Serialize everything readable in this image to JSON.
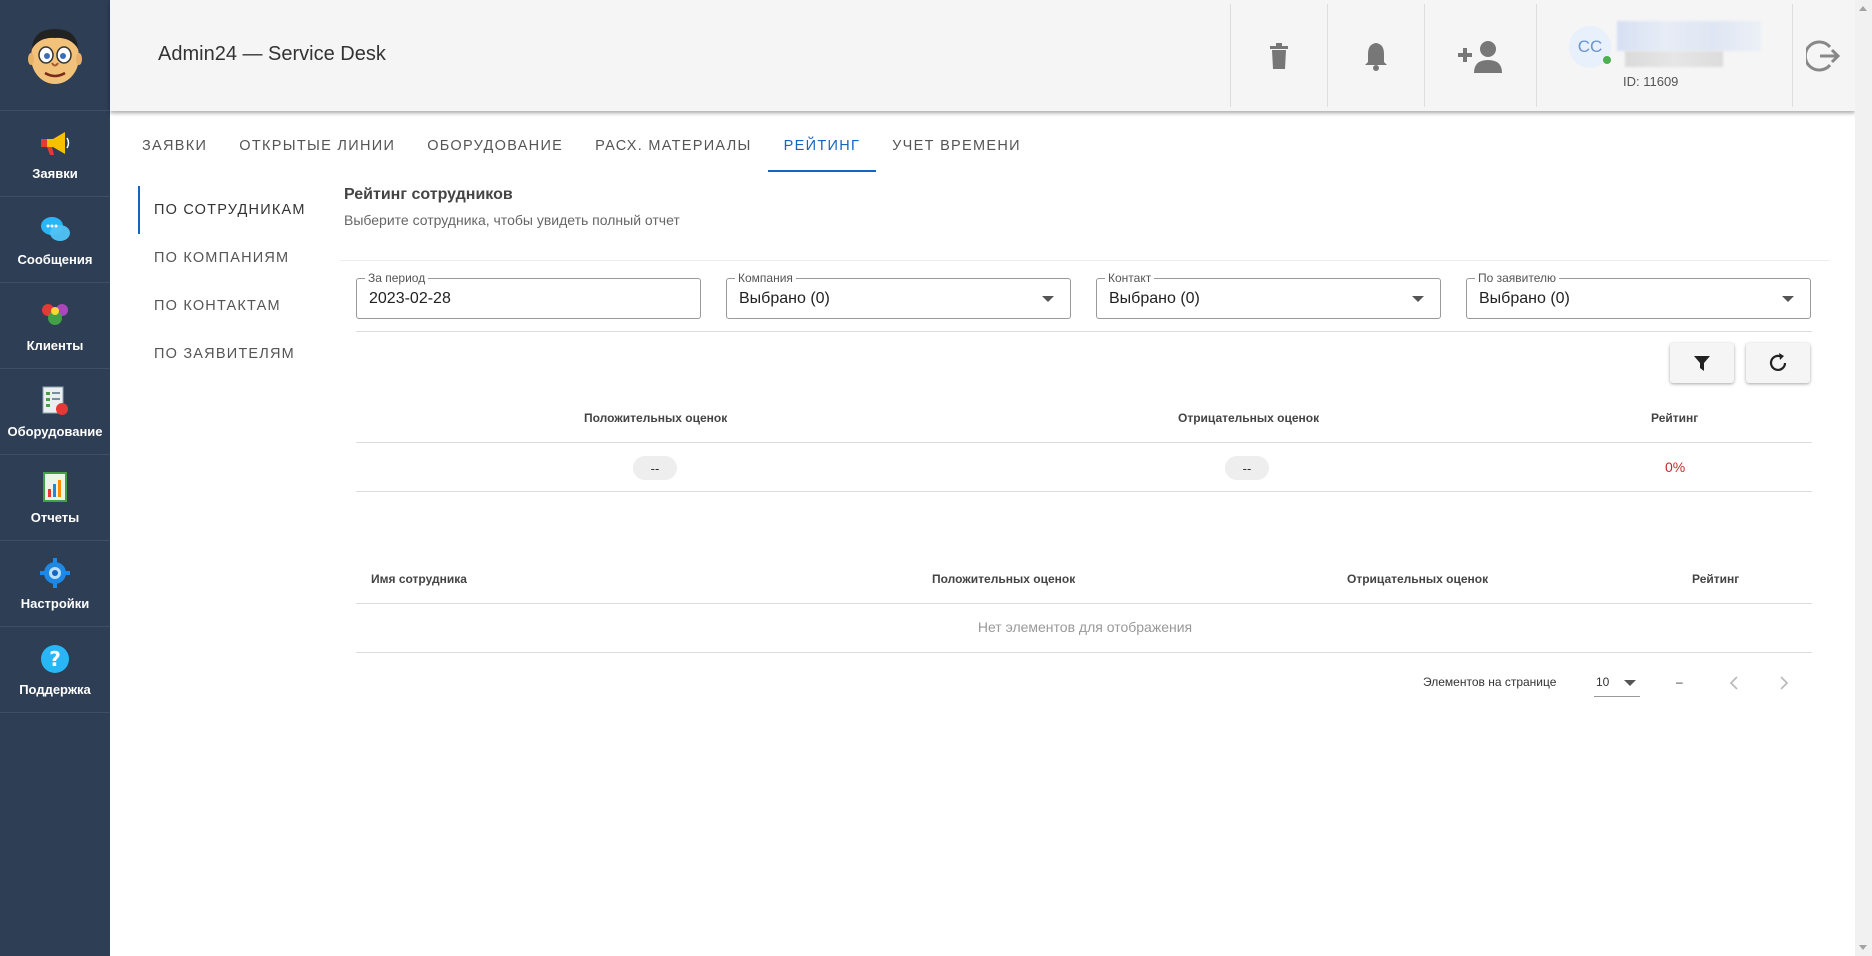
{
  "app": {
    "title": "Admin24 — Service Desk"
  },
  "sidebar": {
    "items": [
      {
        "label": "Заявки",
        "icon": "megaphone-icon"
      },
      {
        "label": "Сообщения",
        "icon": "chat-bubbles-icon"
      },
      {
        "label": "Клиенты",
        "icon": "users-icon"
      },
      {
        "label": "Оборудование",
        "icon": "equipment-icon"
      },
      {
        "label": "Отчеты",
        "icon": "report-chart-icon"
      },
      {
        "label": "Настройки",
        "icon": "gear-icon"
      },
      {
        "label": "Поддержка",
        "icon": "help-icon"
      }
    ]
  },
  "header": {
    "avatar_initials": "CC",
    "user_id": "ID: 11609"
  },
  "tabs": [
    {
      "label": "ЗАЯВКИ"
    },
    {
      "label": "ОТКРЫТЫЕ ЛИНИИ"
    },
    {
      "label": "ОБОРУДОВАНИЕ"
    },
    {
      "label": "РАСХ. МАТЕРИАЛЫ"
    },
    {
      "label": "РЕЙТИНГ"
    },
    {
      "label": "УЧЕТ ВРЕМЕНИ"
    }
  ],
  "subnav": [
    {
      "label": "ПО СОТРУДНИКАМ"
    },
    {
      "label": "ПО КОМПАНИЯМ"
    },
    {
      "label": "ПО КОНТАКТАМ"
    },
    {
      "label": "ПО ЗАЯВИТЕЛЯМ"
    }
  ],
  "page": {
    "title": "Рейтинг сотрудников",
    "subtitle": "Выберите сотрудника, чтобы увидеть полный отчет"
  },
  "filters": {
    "period": {
      "label": "За период",
      "value": "2023-02-28"
    },
    "company": {
      "label": "Компания",
      "value": "Выбрано (0)"
    },
    "contact": {
      "label": "Контакт",
      "value": "Выбрано (0)"
    },
    "requester": {
      "label": "По заявителю",
      "value": "Выбрано (0)"
    }
  },
  "summary": {
    "headers": [
      "Положительных оценок",
      "Отрицательных оценок",
      "Рейтинг"
    ],
    "positive": "--",
    "negative": "--",
    "rating": "0%"
  },
  "table": {
    "headers": [
      "Имя сотрудника",
      "Положительных оценок",
      "Отрицательных оценок",
      "Рейтинг"
    ],
    "empty_text": "Нет элементов для отображения"
  },
  "pager": {
    "per_page_label": "Элементов на странице",
    "per_page_value": "10",
    "range": "–"
  },
  "colors": {
    "sidebar": "#2d3e55",
    "accent": "#1565c0",
    "rating_zero": "#c62828"
  }
}
